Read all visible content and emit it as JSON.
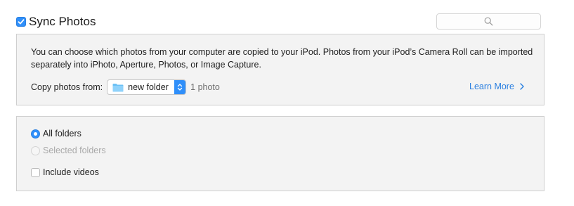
{
  "header": {
    "title": "Sync Photos",
    "sync_checked": true
  },
  "search": {
    "icon": "search-icon"
  },
  "info": {
    "description": "You can choose which photos from your computer are copied to your iPod. Photos from your iPod’s Camera Roll can be imported separately into iPhoto, Aperture, Photos, or Image Capture.",
    "copy_label": "Copy photos from:",
    "source_value": "new folder",
    "photo_count": "1 photo",
    "learn_more": "Learn More"
  },
  "options": {
    "all_folders": "All folders",
    "selected_folders": "Selected folders",
    "include_videos": "Include videos",
    "all_folders_selected": true,
    "include_videos_checked": false
  },
  "colors": {
    "accent": "#2f8ffa",
    "link": "#2a7fe0",
    "panel_bg": "#f3f3f3",
    "panel_border": "#cfcfcf"
  }
}
